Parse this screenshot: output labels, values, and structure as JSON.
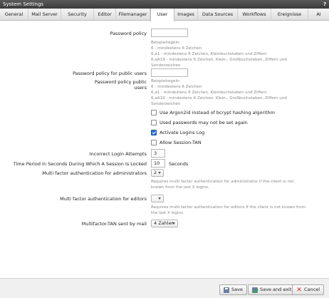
{
  "window": {
    "title": "System Settings",
    "help": "?"
  },
  "tabs": [
    {
      "label": "General"
    },
    {
      "label": "Mail Server"
    },
    {
      "label": "Security"
    },
    {
      "label": "Editor"
    },
    {
      "label": "Filemanager"
    },
    {
      "label": "User"
    },
    {
      "label": "Images"
    },
    {
      "label": "Data Sources"
    },
    {
      "label": "Workflows"
    },
    {
      "label": "Ereignisse"
    },
    {
      "label": "AI"
    }
  ],
  "active_tab": "User",
  "form": {
    "password_policy": {
      "label": "Password policy",
      "value": "",
      "hint": [
        "Beispielregeln:",
        "6 - mindestens 6 Zeichen",
        "6,a1 - mindestens 6 Zeichen, Kleinbuchstaben und Ziffern",
        "6,aA19 - mindestens 6 Zeichen, Klein-, Großbuchstaben, Ziffern und",
        "Sonderzeichen"
      ]
    },
    "password_policy_public": {
      "label": "Password policy for public users",
      "value": "",
      "sub_label_1": "Password policy public",
      "sub_label_2": "users",
      "hint": [
        "Beispielregeln:",
        "6 - mindestens 6 Zeichen",
        "6,a1 - mindestens 6 Zeichen, Kleinbuchstaben und Ziffern",
        "6,aA19 - mindestens 6 Zeichen, Klein-, Großbuchstaben, Ziffern und",
        "Sonderzeichen"
      ]
    },
    "checkboxes": [
      {
        "label": "Use Argon2id instead of bcrypt hashing algorithm",
        "checked": false
      },
      {
        "label": "Used passwords may not be set again",
        "checked": false
      },
      {
        "label": "Activate Logins Log",
        "checked": true
      },
      {
        "label": "Allow Session-TAN",
        "checked": false
      }
    ],
    "incorrect_login": {
      "label": "Incorrect Login Attempts",
      "value": "3"
    },
    "session_lock": {
      "label": "Time Period In Seconds During Which A Session Is Locked",
      "value": "10",
      "unit": "Seconds"
    },
    "mfa_admins": {
      "label": "Multi factor authentication for administrators",
      "value": "2",
      "hint": [
        "Requires multi factor authentication for administrator if the client is not",
        "known from the last X logins."
      ]
    },
    "mfa_editors": {
      "label": "Multi factor authentication for editors",
      "value": "",
      "hint": [
        "Requires multi factor authentication for editors if the client is not known from",
        "the last X logins."
      ]
    },
    "mfa_tan_mail": {
      "label": "Multifactor-TAN sent by mail",
      "value": "4 Zahlen"
    }
  },
  "footer": {
    "save": "Save",
    "save_exit": "Save and exit",
    "cancel": "Cancel"
  }
}
